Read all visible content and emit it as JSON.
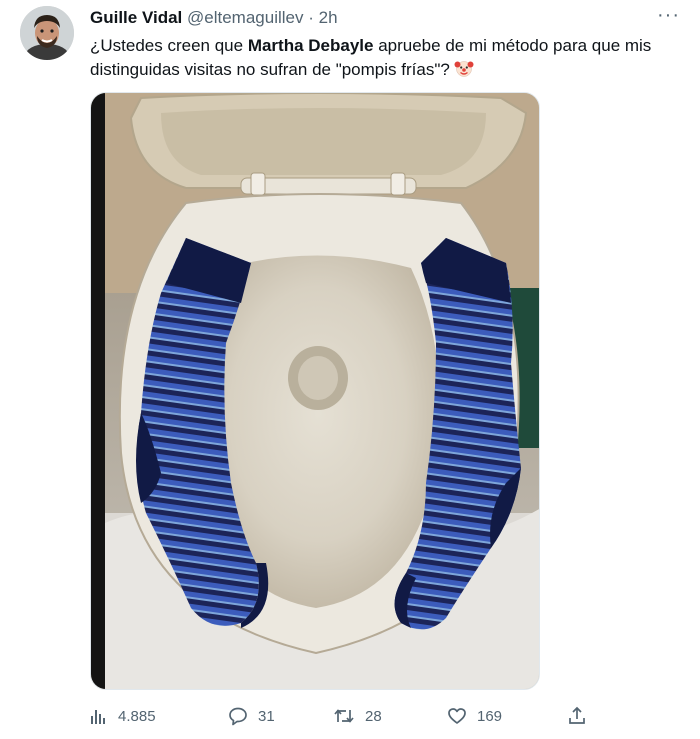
{
  "tweet": {
    "author_name": "Guille Vidal",
    "author_handle": "@eltemaguillev",
    "separator": "·",
    "time": "2h",
    "more_label": "···",
    "text_part1": "¿Ustedes creen que ",
    "text_mention": "Martha Debayle",
    "text_part2": " apruebe de mi método para que mis distinguidas visitas no sufran de \"pompis frías\"?",
    "emoji": "clown-face-icon"
  },
  "stats": {
    "views": "4.885",
    "replies": "31",
    "retweets": "28",
    "likes": "169"
  },
  "colors": {
    "text_primary": "#0f1419",
    "text_secondary": "#536471",
    "sock_dark": "#1a2150",
    "sock_blue": "#3e5fbf",
    "sock_light": "#7fa8dc"
  }
}
